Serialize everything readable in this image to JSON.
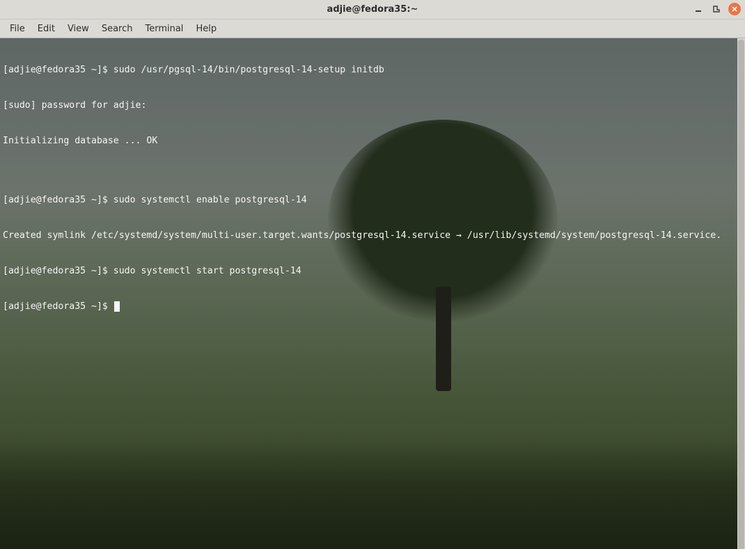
{
  "window": {
    "title": "adjie@fedora35:~"
  },
  "controls": {
    "minimize_icon": "minimize-icon",
    "maximize_icon": "maximize-icon",
    "close_icon": "close-icon"
  },
  "menubar": {
    "items": [
      {
        "label": "File"
      },
      {
        "label": "Edit"
      },
      {
        "label": "View"
      },
      {
        "label": "Search"
      },
      {
        "label": "Terminal"
      },
      {
        "label": "Help"
      }
    ]
  },
  "terminal": {
    "lines": [
      "[adjie@fedora35 ~]$ sudo /usr/pgsql-14/bin/postgresql-14-setup initdb",
      "[sudo] password for adjie:",
      "Initializing database ... OK",
      "",
      "[adjie@fedora35 ~]$ sudo systemctl enable postgresql-14",
      "Created symlink /etc/systemd/system/multi-user.target.wants/postgresql-14.service → /usr/lib/systemd/system/postgresql-14.service.",
      "[adjie@fedora35 ~]$ sudo systemctl start postgresql-14",
      "[adjie@fedora35 ~]$ "
    ]
  }
}
